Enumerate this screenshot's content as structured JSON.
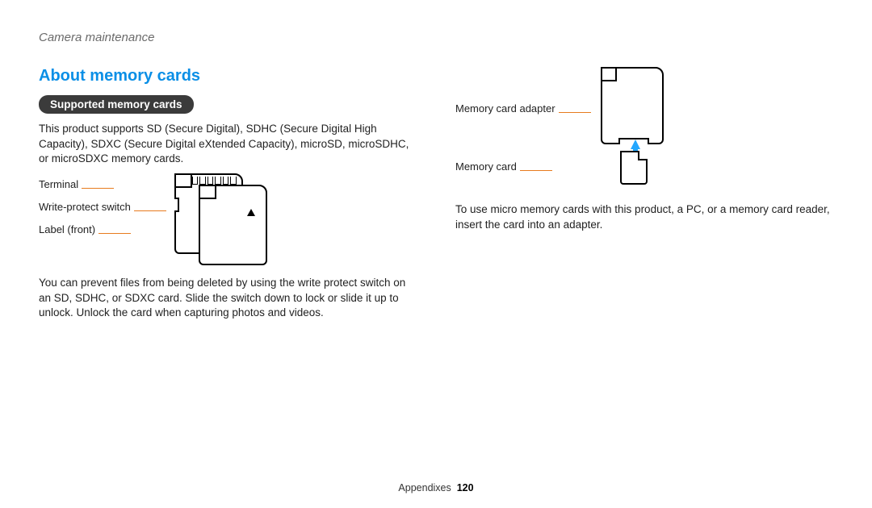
{
  "breadcrumb": "Camera maintenance",
  "section_title": "About memory cards",
  "pill": "Supported memory cards",
  "para1": "This product supports SD (Secure Digital), SDHC (Secure Digital High Capacity), SDXC (Secure Digital eXtended Capacity), microSD, microSDHC, or microSDXC memory cards.",
  "fig1": {
    "terminal": "Terminal",
    "write_protect": "Write-protect switch",
    "label_front": "Label (front)"
  },
  "para2": "You can prevent files from being deleted by using the write protect switch on an SD, SDHC, or SDXC card. Slide the switch down to lock or slide it up to unlock. Unlock the card when capturing photos and videos.",
  "fig2": {
    "adapter": "Memory card adapter",
    "card": "Memory card"
  },
  "para3": "To use micro memory cards with this product, a PC, or a memory card reader, insert the card into an adapter.",
  "footer": {
    "section": "Appendixes",
    "page": "120"
  }
}
